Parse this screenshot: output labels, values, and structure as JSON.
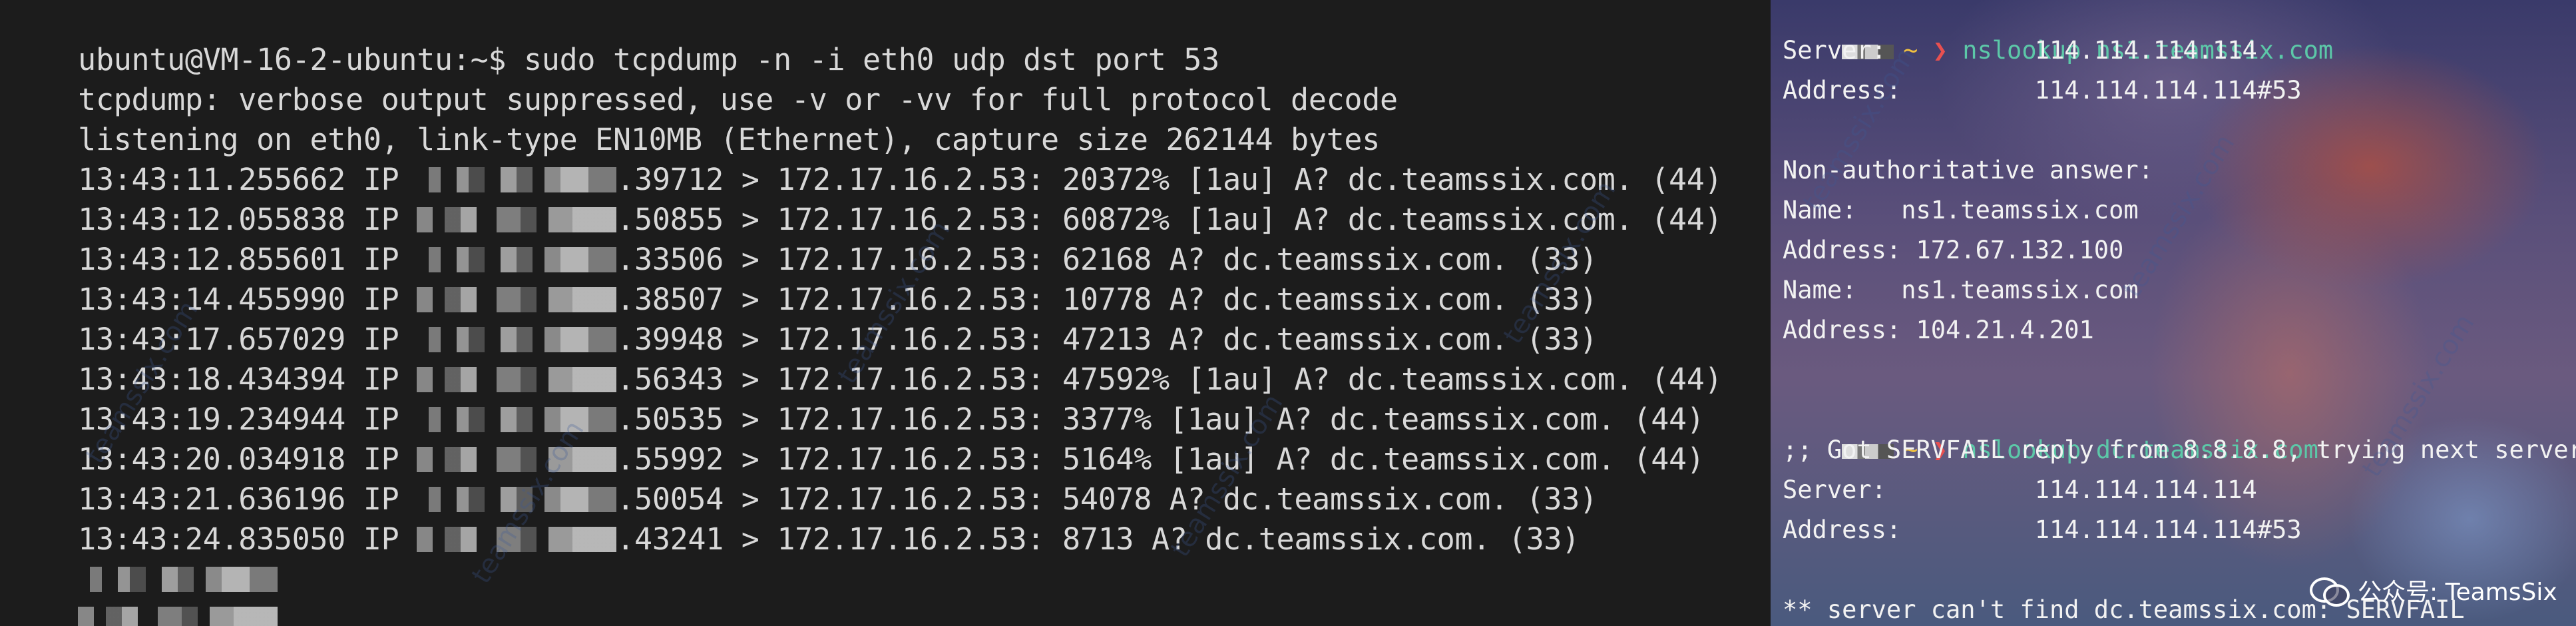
{
  "left_terminal": {
    "lines": [
      {
        "text": "ubuntu@VM-16-2-ubuntu:~$ sudo tcpdump -n -i eth0 udp dst port 53"
      },
      {
        "text": "tcpdump: verbose output suppressed, use -v or -vv for full protocol decode"
      },
      {
        "text": "listening on eth0, link-type EN10MB (Ethernet), capture size 262144 bytes"
      },
      {
        "time": "13:43:11.255662 IP ",
        "rest": ".39712 > 172.17.16.2.53: 20372% [1au] A? dc.teamssix.com. (44)"
      },
      {
        "time": "13:43:12.055838 IP ",
        "rest": ".50855 > 172.17.16.2.53: 60872% [1au] A? dc.teamssix.com. (44)"
      },
      {
        "time": "13:43:12.855601 IP ",
        "rest": ".33506 > 172.17.16.2.53: 62168 A? dc.teamssix.com. (33)"
      },
      {
        "time": "13:43:14.455990 IP ",
        "rest": ".38507 > 172.17.16.2.53: 10778 A? dc.teamssix.com. (33)"
      },
      {
        "time": "13:43:17.657029 IP ",
        "rest": ".39948 > 172.17.16.2.53: 47213 A? dc.teamssix.com. (33)"
      },
      {
        "time": "13:43:18.434394 IP ",
        "rest": ".56343 > 172.17.16.2.53: 47592% [1au] A? dc.teamssix.com. (44)"
      },
      {
        "time": "13:43:19.234944 IP ",
        "rest": ".50535 > 172.17.16.2.53: 3377% [1au] A? dc.teamssix.com. (44)"
      },
      {
        "time": "13:43:20.034918 IP ",
        "rest": ".55992 > 172.17.16.2.53: 5164% [1au] A? dc.teamssix.com. (44)"
      },
      {
        "time": "13:43:21.636196 IP ",
        "rest": ".50054 > 172.17.16.2.53: 54078 A? dc.teamssix.com. (33)"
      },
      {
        "time": "13:43:24.835050 IP ",
        "rest": ".43241 > 172.17.16.2.53: 8713 A? dc.teamssix.com. (33)"
      }
    ]
  },
  "right_terminal": {
    "prompt_tilde": "~",
    "prompt_arrow": "❯",
    "cmd1": "nslookup ns1.teamssix.com",
    "cmd2": "nslookup dc.teamssix.com",
    "out1": [
      "Server:          114.114.114.114",
      "Address:         114.114.114.114#53",
      "",
      "Non-authoritative answer:",
      "Name:   ns1.teamssix.com",
      "Address: 172.67.132.100",
      "Name:   ns1.teamssix.com",
      "Address: 104.21.4.201"
    ],
    "out2": [
      ";; Got SERVFAIL reply from 8.8.8.8, trying next server",
      "Server:          114.114.114.114",
      "Address:         114.114.114.114#53",
      "",
      "** server can't find dc.teamssix.com: SERVFAIL"
    ]
  },
  "watermark_text": "teamssix.com",
  "wechat_badge": "公众号: TeamsSix"
}
